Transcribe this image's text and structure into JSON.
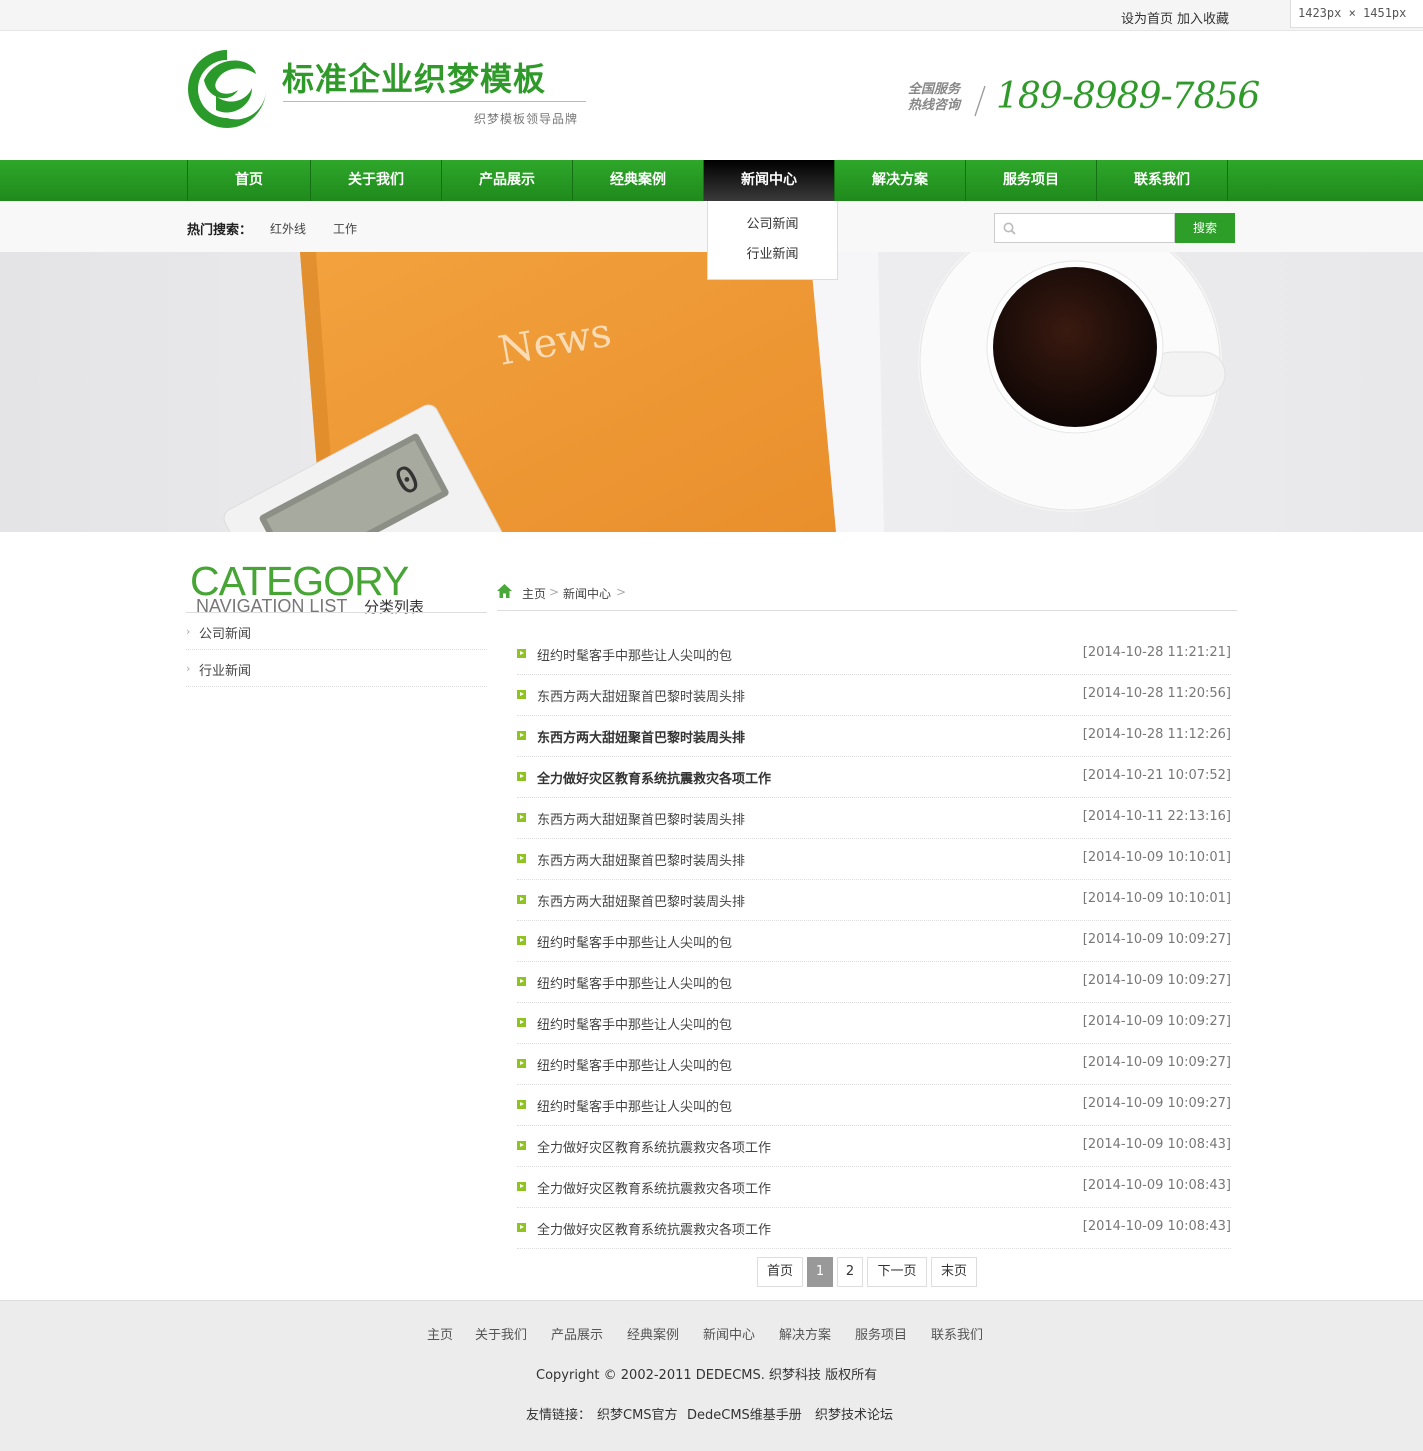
{
  "topbar": {
    "set_home": "设为首页",
    "add_favorite": "加入收藏",
    "dimension_badge": "1423px  ×  1451px"
  },
  "header": {
    "logo_title": "标准企业织梦模板",
    "logo_subtitle": "织梦模板领导品牌",
    "hotline_label_1": "全国服务",
    "hotline_label_2": "热线咨询",
    "phone": "189-8989-7856",
    "brand_color": "#2f9a2a"
  },
  "nav": {
    "items": [
      {
        "label": "首页"
      },
      {
        "label": "关于我们"
      },
      {
        "label": "产品展示"
      },
      {
        "label": "经典案例"
      },
      {
        "label": "新闻中心"
      },
      {
        "label": "解决方案"
      },
      {
        "label": "服务项目"
      },
      {
        "label": "联系我们"
      }
    ],
    "active": "新闻中心",
    "dropdown": [
      "公司新闻",
      "行业新闻"
    ]
  },
  "search": {
    "hot_label": "热门搜索：",
    "hot_terms": [
      "红外线",
      "工作"
    ],
    "placeholder": "",
    "button_label": "搜索"
  },
  "banner": {
    "notebook_text": "News"
  },
  "sidebar": {
    "title_en": "CATEGORY",
    "subtitle_en": "NAVIGATION LIST",
    "subtitle_cn": "分类列表",
    "items": [
      "公司新闻",
      "行业新闻"
    ]
  },
  "breadcrumb": {
    "home": "主页",
    "sep": ">",
    "current": "新闻中心"
  },
  "news": [
    {
      "title": "纽约时髦客手中那些让人尖叫的包",
      "date": "[2014-10-28 11:21:21]",
      "bold": false
    },
    {
      "title": "东西方两大甜妞聚首巴黎时装周头排",
      "date": "[2014-10-28 11:20:56]",
      "bold": false
    },
    {
      "title": "东西方两大甜妞聚首巴黎时装周头排",
      "date": "[2014-10-28 11:12:26]",
      "bold": true
    },
    {
      "title": "全力做好灾区教育系统抗震救灾各项工作",
      "date": "[2014-10-21 10:07:52]",
      "bold": true
    },
    {
      "title": "东西方两大甜妞聚首巴黎时装周头排",
      "date": "[2014-10-11 22:13:16]",
      "bold": false
    },
    {
      "title": "东西方两大甜妞聚首巴黎时装周头排",
      "date": "[2014-10-09 10:10:01]",
      "bold": false
    },
    {
      "title": "东西方两大甜妞聚首巴黎时装周头排",
      "date": "[2014-10-09 10:10:01]",
      "bold": false
    },
    {
      "title": "纽约时髦客手中那些让人尖叫的包",
      "date": "[2014-10-09 10:09:27]",
      "bold": false
    },
    {
      "title": "纽约时髦客手中那些让人尖叫的包",
      "date": "[2014-10-09 10:09:27]",
      "bold": false
    },
    {
      "title": "纽约时髦客手中那些让人尖叫的包",
      "date": "[2014-10-09 10:09:27]",
      "bold": false
    },
    {
      "title": "纽约时髦客手中那些让人尖叫的包",
      "date": "[2014-10-09 10:09:27]",
      "bold": false
    },
    {
      "title": "纽约时髦客手中那些让人尖叫的包",
      "date": "[2014-10-09 10:09:27]",
      "bold": false
    },
    {
      "title": "全力做好灾区教育系统抗震救灾各项工作",
      "date": "[2014-10-09 10:08:43]",
      "bold": false
    },
    {
      "title": "全力做好灾区教育系统抗震救灾各项工作",
      "date": "[2014-10-09 10:08:43]",
      "bold": false
    },
    {
      "title": "全力做好灾区教育系统抗震救灾各项工作",
      "date": "[2014-10-09 10:08:43]",
      "bold": false
    }
  ],
  "pagination": {
    "first": "首页",
    "pages": [
      "1",
      "2"
    ],
    "current": "1",
    "next": "下一页",
    "last": "末页"
  },
  "footer": {
    "nav": [
      "主页",
      "关于我们",
      "产品展示",
      "经典案例",
      "新闻中心",
      "解决方案",
      "服务项目",
      "联系我们"
    ],
    "copyright": "Copyright © 2002-2011 DEDECMS. 织梦科技 版权所有",
    "friend_label": "友情链接：",
    "friend_links": [
      "织梦CMS官方",
      "DedeCMS维基手册",
      "织梦技术论坛"
    ]
  }
}
